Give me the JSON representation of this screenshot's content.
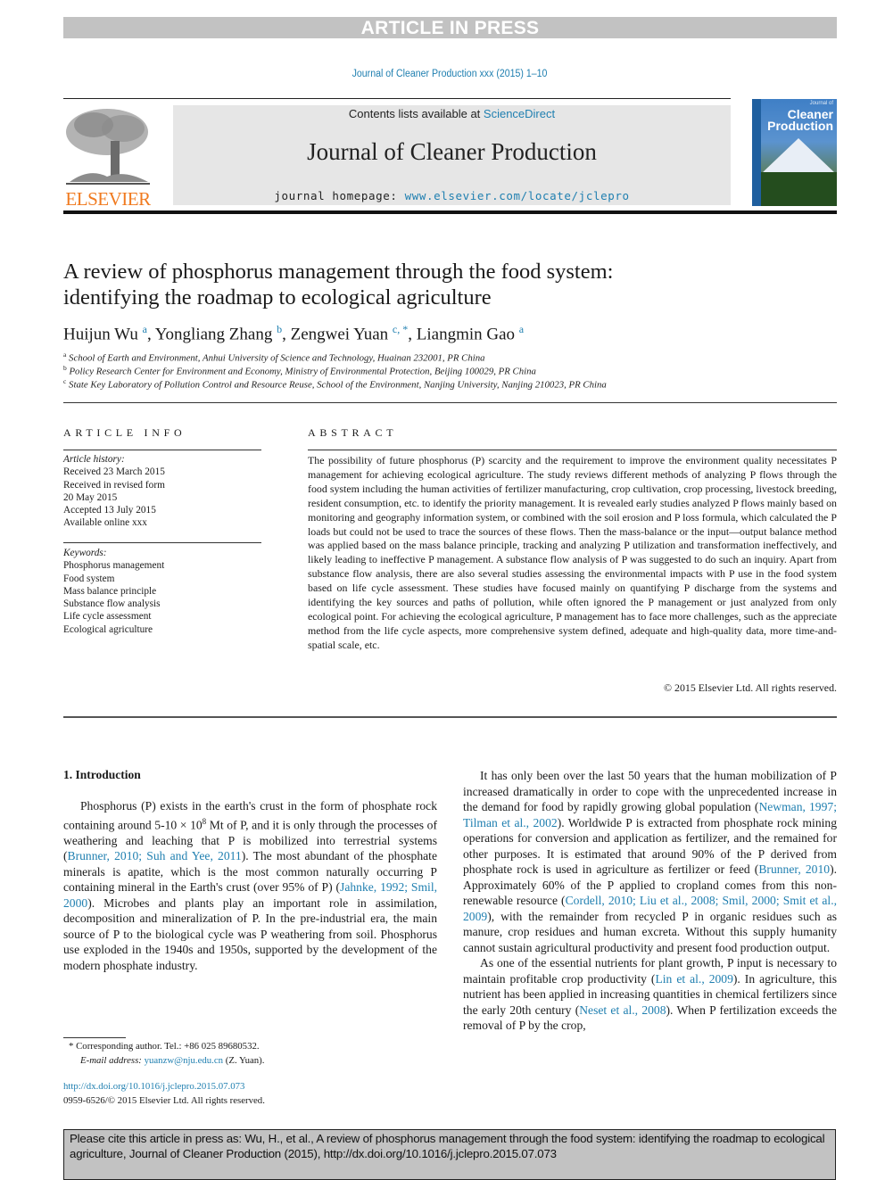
{
  "banner": "ARTICLE IN PRESS",
  "running_head": "Journal of Cleaner Production xxx (2015) 1–10",
  "publisher": {
    "wordmark": "ELSEVIER",
    "logo_icon": "elsevier-tree-logo"
  },
  "masthead": {
    "contents_prefix": "Contents lists available at ",
    "contents_link": "ScienceDirect",
    "journal_name": "Journal of Cleaner Production",
    "homepage_prefix": "journal homepage: ",
    "homepage_link": "www.elsevier.com/locate/jclepro"
  },
  "cover": {
    "small_title": "Journal of",
    "title_line1": "Cleaner",
    "title_line2": "Production"
  },
  "article": {
    "title_line1": "A review of phosphorus management through the food system:",
    "title_line2": "identifying the roadmap to ecological agriculture",
    "authors": [
      {
        "name": "Huijun Wu",
        "sup": "a",
        "sep": ", "
      },
      {
        "name": "Yongliang Zhang",
        "sup": "b",
        "sep": ", "
      },
      {
        "name": "Zengwei Yuan",
        "sup": "c, *",
        "sep": ", "
      },
      {
        "name": "Liangmin Gao",
        "sup": "a",
        "sep": ""
      }
    ],
    "affiliations": [
      {
        "mark": "a",
        "text": "School of Earth and Environment, Anhui University of Science and Technology, Huainan 232001, PR China"
      },
      {
        "mark": "b",
        "text": "Policy Research Center for Environment and Economy, Ministry of Environmental Protection, Beijing 100029, PR China"
      },
      {
        "mark": "c",
        "text": "State Key Laboratory of Pollution Control and Resource Reuse, School of the Environment, Nanjing University, Nanjing 210023, PR China"
      }
    ]
  },
  "article_info": {
    "heading": "ARTICLE INFO",
    "history_label": "Article history:",
    "history": [
      "Received 23 March 2015",
      "Received in revised form",
      "20 May 2015",
      "Accepted 13 July 2015",
      "Available online xxx"
    ],
    "keywords_label": "Keywords:",
    "keywords": [
      "Phosphorus management",
      "Food system",
      "Mass balance principle",
      "Substance flow analysis",
      "Life cycle assessment",
      "Ecological agriculture"
    ]
  },
  "abstract": {
    "heading": "ABSTRACT",
    "text": "The possibility of future phosphorus (P) scarcity and the requirement to improve the environment quality necessitates P management for achieving ecological agriculture. The study reviews different methods of analyzing P flows through the food system including the human activities of fertilizer manufacturing, crop cultivation, crop processing, livestock breeding, resident consumption, etc. to identify the priority management. It is revealed early studies analyzed P flows mainly based on moni­toring and geography information system, or combined with the soil erosion and P loss formula, which calculated the P loads but could not be used to trace the sources of these flows. Then the mass-balance or the input—output balance method was applied based on the mass balance principle, tracking and analyzing P utilization and transformation ineffectively, and likely leading to ineffective P management. A substance flow analysis of P was suggested to do such an inquiry. Apart from substance flow analysis, there are also several studies assessing the environmental impacts with P use in the food system based on life cycle assessment. These studies have focused mainly on quantifying P discharge from the systems and identifying the key sources and paths of pollution, while often ignored the P management or just analyzed from only ecological point. For achieving the ecological agriculture, P management has to face more challenges, such as the appreciate method from the life cycle aspects, more comprehensive system defined, adequate and high-quality data, more time-and-spatial scale, etc.",
    "copyright": "© 2015 Elsevier Ltd. All rights reserved."
  },
  "intro": {
    "heading": "1.  Introduction",
    "left_paragraph": [
      {
        "t": "Phosphorus (P) exists in the earth's crust in the form of phos­phate rock containing around 5-10 × 10"
      },
      {
        "sup": "8"
      },
      {
        "t": " Mt of P, and it is only through the processes of weathering and leaching that P is mobi­lized into terrestrial systems ("
      },
      {
        "link": "Brunner, 2010; Suh and Yee, 2011"
      },
      {
        "t": "). The most abundant of the phosphate minerals is apatite, which is the most common naturally occurring P containing mineral in the Earth's crust (over 95% of P) ("
      },
      {
        "link": "Jahnke, 1992; Smil, 2000"
      },
      {
        "t": "). Microbes and plants play an important role in assimilation, decomposition and mineralization of P. In the pre-industrial era, the main source of P to the biological cycle was P weathering from soil. Phosphorus use exploded in the 1940s and 1950s, supported by the development of the modern phosphate industry."
      }
    ],
    "right_paragraph_1": [
      {
        "t": "It has only been over the last 50 years that the human mobili­zation of P increased dramatically in order to cope with the un­precedented increase in the demand for food by rapidly growing global population ("
      },
      {
        "link": "Newman, 1997; Tilman et al., 2002"
      },
      {
        "t": "). Worldwide P is extracted from phosphate rock mining operations for conver­sion and application as fertilizer, and the remained for other pur­poses. It is estimated that around 90% of the P derived from phosphate rock is used in agriculture as fertilizer or feed ("
      },
      {
        "link": "Brunner, 2010"
      },
      {
        "t": "). Approximately 60% of the P applied to cropland comes from this non-renewable resource ("
      },
      {
        "link": "Cordell, 2010; Liu et al., 2008; Smil, 2000; Smit et al., 2009"
      },
      {
        "t": "), with the remainder from recycled P in organic residues such as manure, crop residues and human excreta. Without this supply humanity cannot sustain agricultural produc­tivity and present food production output."
      }
    ],
    "right_paragraph_2": [
      {
        "t": "As one of the essential nutrients for plant growth, P input is necessary to maintain profitable crop productivity ("
      },
      {
        "link": "Lin et al., 2009"
      },
      {
        "t": "). In agriculture, this nutrient has been applied in increasing quanti­ties in chemical fertilizers since the early 20th century ("
      },
      {
        "link": "Neset et al., 2008"
      },
      {
        "t": "). When P fertilization exceeds the removal of P by the crop,"
      }
    ]
  },
  "footnote": {
    "corresponding": "* Corresponding author. Tel.: +86 025 89680532.",
    "email_label": "E-mail address: ",
    "email": "yuanzw@nju.edu.cn",
    "email_suffix": " (Z. Yuan)."
  },
  "doi": {
    "link": "http://dx.doi.org/10.1016/j.jclepro.2015.07.073",
    "issn_line": "0959-6526/© 2015 Elsevier Ltd. All rights reserved."
  },
  "citation_box": "Please cite this article in press as: Wu, H., et al., A review of phosphorus management through the food system: identifying the roadmap to ecological agriculture, Journal of Cleaner Production (2015), http://dx.doi.org/10.1016/j.jclepro.2015.07.073"
}
